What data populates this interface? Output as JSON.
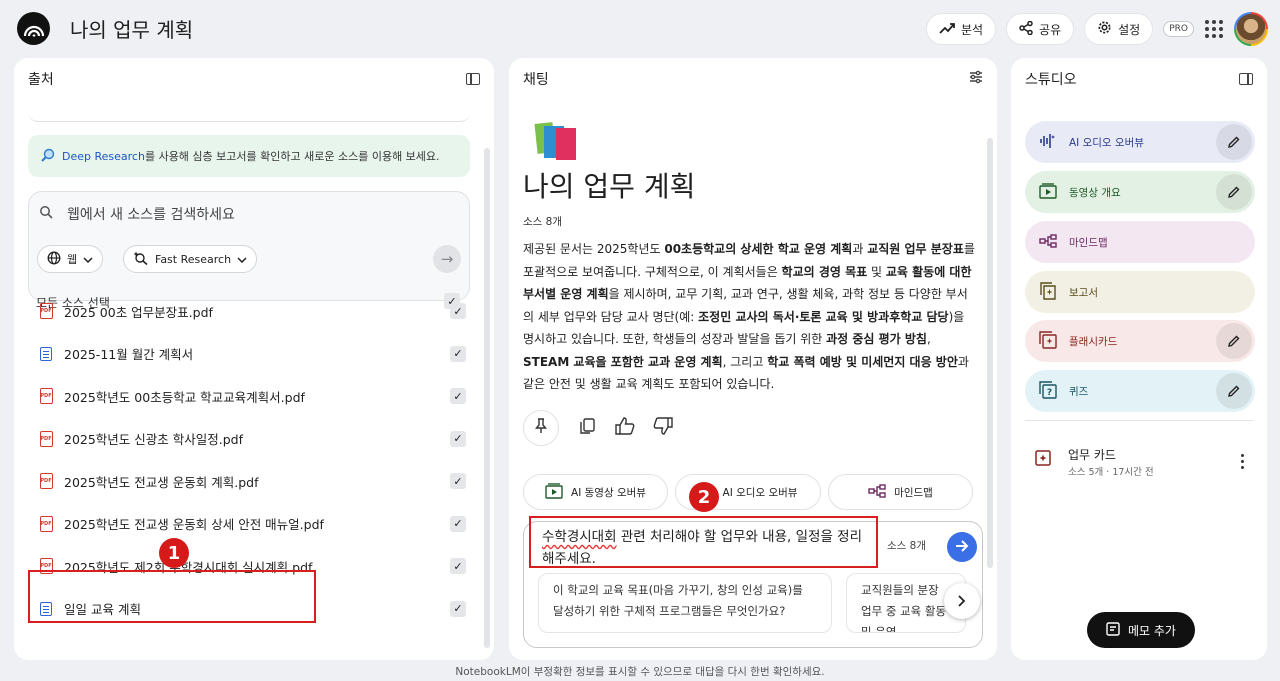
{
  "app": {
    "title": "나의 업무 계획"
  },
  "header": {
    "analytics_label": "분석",
    "share_label": "공유",
    "settings_label": "설정",
    "pro_badge": "PRO"
  },
  "sources_panel": {
    "title": "출처",
    "deep_research": {
      "link": "Deep Research",
      "text": "를 사용해 심층 보고서를 확인하고 새로운 소스를 이용해 보세요."
    },
    "search_placeholder": "웹에서 새 소스를 검색하세요",
    "web_chip": "웹",
    "research_chip": "Fast Research",
    "select_all": "모든 소스 선택",
    "items": [
      {
        "type": "pdf",
        "name": "2025 00초 업무분장표.pdf"
      },
      {
        "type": "doc",
        "name": "2025-11월 월간 계획서"
      },
      {
        "type": "pdf",
        "name": "2025학년도 00초등학교 학교교육계획서.pdf"
      },
      {
        "type": "pdf",
        "name": "2025학년도 신광초 학사일정.pdf"
      },
      {
        "type": "pdf",
        "name": "2025학년도 전교생 운동회 계획.pdf"
      },
      {
        "type": "pdf",
        "name": "2025학년도 전교생 운동회 상세 안전 매뉴얼.pdf"
      },
      {
        "type": "pdf",
        "name": "2025학년도 제2회 수학경시대회 실시계획.pdf"
      },
      {
        "type": "doc",
        "name": "일일 교육 계획"
      }
    ]
  },
  "chat_panel": {
    "title": "채팅",
    "notebook_title": "나의 업무 계획",
    "source_count": "소스 8개",
    "summary_parts": [
      [
        "제공된 문서는 2025학년도 ",
        ""
      ],
      [
        "00초등학교의 상세한 학교 운영 계획",
        "b"
      ],
      [
        "과 ",
        ""
      ],
      [
        "교직원 업무 분장표",
        "b"
      ],
      [
        "를 포괄적으로 보여줍니다. 구체적으로, 이 계획서들은 ",
        ""
      ],
      [
        "학교의 경영 목표",
        "b"
      ],
      [
        " 및 ",
        ""
      ],
      [
        "교육 활동에 대한 부서별 운영 계획",
        "b"
      ],
      [
        "을 제시하며, 교무 기획, 교과 연구, 생활 체육, 과학 정보 등 다양한 부서의 세부 업무와 담당 교사 명단(예: ",
        ""
      ],
      [
        "조정민 교사의 독서·토론 교육 및 방과후학교 담당",
        "b"
      ],
      [
        ")을 명시하고 있습니다. 또한, 학생들의 성장과 발달을 돕기 위한 ",
        ""
      ],
      [
        "과정 중심 평가 방침",
        "b"
      ],
      [
        ", ",
        ""
      ],
      [
        "STEAM 교육을 포함한 교과 운영 계획",
        "b"
      ],
      [
        ", 그리고 ",
        ""
      ],
      [
        "학교 폭력 예방 및 미세먼지 대응 방안",
        "b"
      ],
      [
        "과 같은 안전 및 생활 교육 계획도 포함되어 있습니다.",
        ""
      ]
    ],
    "tool_chips": [
      "AI 동영상 오버뷰",
      "AI 오디오 오버뷰",
      "마인드맵"
    ],
    "composer_text": "수학경시대회 관련 처리해야 할 업무와 내용, 일정을 정리해주세요.",
    "composer_text_misspelled": "수학경시대회",
    "composer_text_rest": " 관련 처리해야 할 업무와 내용, 일정을 정리해주세요.",
    "composer_source_count": "소스 8개",
    "suggestions": [
      "이 학교의 교육 목표(마음 가꾸기, 창의 인성 교육)를 달성하기 위한 구체적 프로그램들은 무엇인가요?",
      "교직원들의 분장 업무 중 교육 활동 및 운영"
    ]
  },
  "studio_panel": {
    "title": "스튜디오",
    "items": [
      {
        "label": "AI 오디오 오버뷰",
        "bg": "#e8eaf6",
        "color": "#2b3a8f",
        "edit": true
      },
      {
        "label": "동영상 개요",
        "bg": "#e3f1e4",
        "color": "#1f5a2a",
        "edit": true
      },
      {
        "label": "마인드맵",
        "bg": "#f3e7f1",
        "color": "#6c2a63",
        "edit": false
      },
      {
        "label": "보고서",
        "bg": "#f2f0e4",
        "color": "#5b4d1c",
        "edit": false
      },
      {
        "label": "플래시카드",
        "bg": "#f8e9e8",
        "color": "#8a2522",
        "edit": true
      },
      {
        "label": "퀴즈",
        "bg": "#e2f2f6",
        "color": "#1a5566",
        "edit": true
      }
    ],
    "note": {
      "title": "업무 카드",
      "subtitle": "소스 5개 · 17시간 전"
    },
    "add_note_label": "메모 추가"
  },
  "annotations": {
    "marker_1": "1",
    "marker_2": "2"
  },
  "footer": {
    "disclaimer": "NotebookLM이 부정확한 정보를 표시할 수 있으므로 대답을 다시 한번 확인하세요."
  }
}
